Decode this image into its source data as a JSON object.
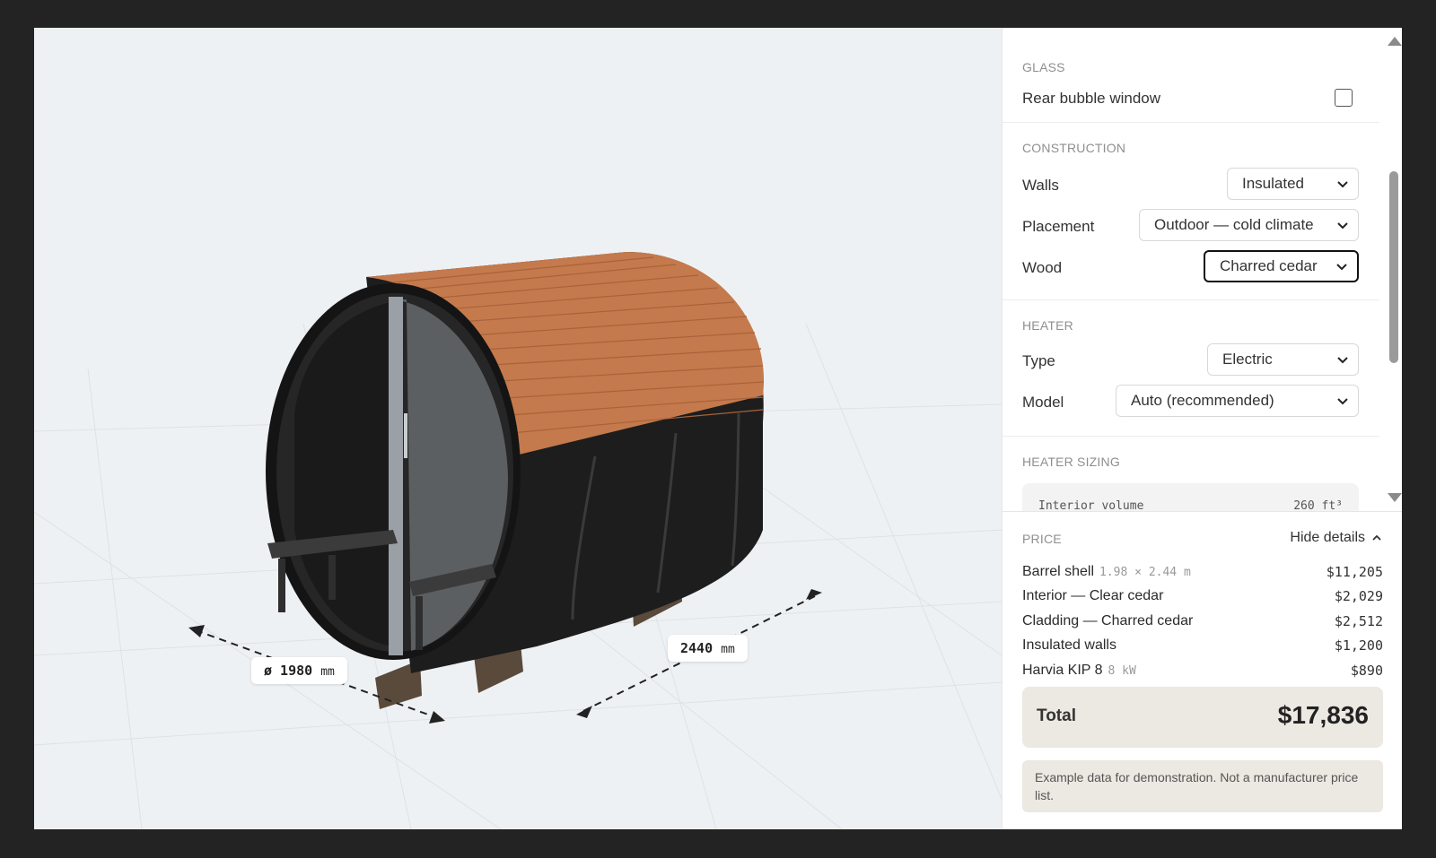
{
  "viewer": {
    "diameter_label": "ø 1980",
    "diameter_unit": "mm",
    "length_label": "2440",
    "length_unit": "mm"
  },
  "config": {
    "glass": {
      "title": "GLASS",
      "rear_window_label": "Rear bubble window",
      "rear_window_checked": false
    },
    "construction": {
      "title": "CONSTRUCTION",
      "walls_label": "Walls",
      "walls_value": "Insulated",
      "placement_label": "Placement",
      "placement_value": "Outdoor — cold climate",
      "wood_label": "Wood",
      "wood_value": "Charred cedar"
    },
    "heater": {
      "title": "HEATER",
      "type_label": "Type",
      "type_value": "Electric",
      "model_label": "Model",
      "model_value": "Auto (recommended)"
    },
    "heater_sizing": {
      "title": "HEATER SIZING",
      "row_label": "Interior volume",
      "row_value": "260 ft³"
    }
  },
  "price": {
    "title": "PRICE",
    "toggle_label": "Hide details",
    "lines": [
      {
        "label": "Barrel shell",
        "note": "1.98 × 2.44 m",
        "amount": "$11,205"
      },
      {
        "label": "Interior — Clear cedar",
        "note": "",
        "amount": "$2,029"
      },
      {
        "label": "Cladding — Charred cedar",
        "note": "",
        "amount": "$2,512"
      },
      {
        "label": "Insulated walls",
        "note": "",
        "amount": "$1,200"
      },
      {
        "label": "Harvia KIP 8",
        "note": "8 kW",
        "amount": "$890"
      }
    ],
    "total_label": "Total",
    "total_value": "$17,836",
    "disclaimer": "Example data for demonstration. Not a manufacturer price list."
  },
  "colors": {
    "roof": "#c47a4c",
    "barrel": "#1f1f1f",
    "viewer_bg": "#eef1f4",
    "total_bg": "#ece8e2"
  }
}
